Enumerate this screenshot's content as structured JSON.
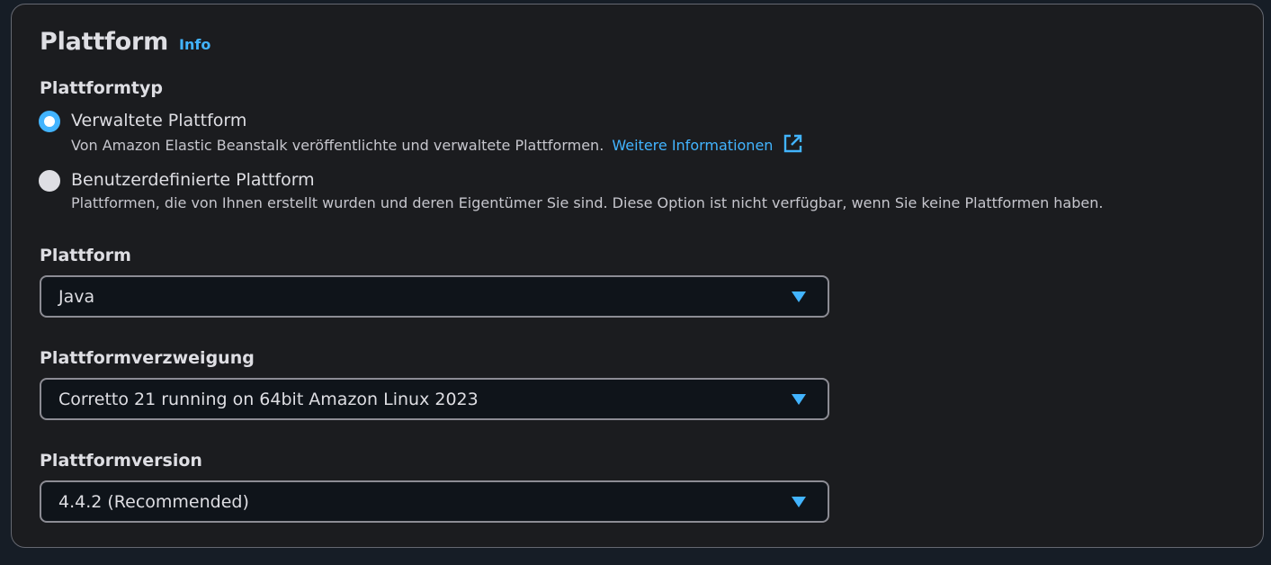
{
  "panel": {
    "title": "Plattform",
    "info_link": "Info"
  },
  "platform_type": {
    "label": "Plattformtyp",
    "options": [
      {
        "title": "Verwaltete Plattform",
        "description": "Von Amazon Elastic Beanstalk veröffentlichte und verwaltete Plattformen.",
        "link": "Weitere Informationen",
        "selected": true
      },
      {
        "title": "Benutzerdefinierte Plattform",
        "description": "Plattformen, die von Ihnen erstellt wurden und deren Eigentümer Sie sind. Diese Option ist nicht verfügbar, wenn Sie keine Plattformen haben.",
        "selected": false
      }
    ]
  },
  "platform": {
    "label": "Plattform",
    "value": "Java"
  },
  "branch": {
    "label": "Plattformverzweigung",
    "value": "Corretto 21 running on 64bit Amazon Linux 2023"
  },
  "version": {
    "label": "Plattformversion",
    "value": "4.4.2 (Recommended)"
  },
  "colors": {
    "accent": "#42b4ff",
    "background": "#1b1c1f",
    "border": "#656871",
    "text": "#dedee3"
  },
  "icons": {
    "external_link": "external-link-icon",
    "dropdown_caret": "caret-down-icon"
  }
}
